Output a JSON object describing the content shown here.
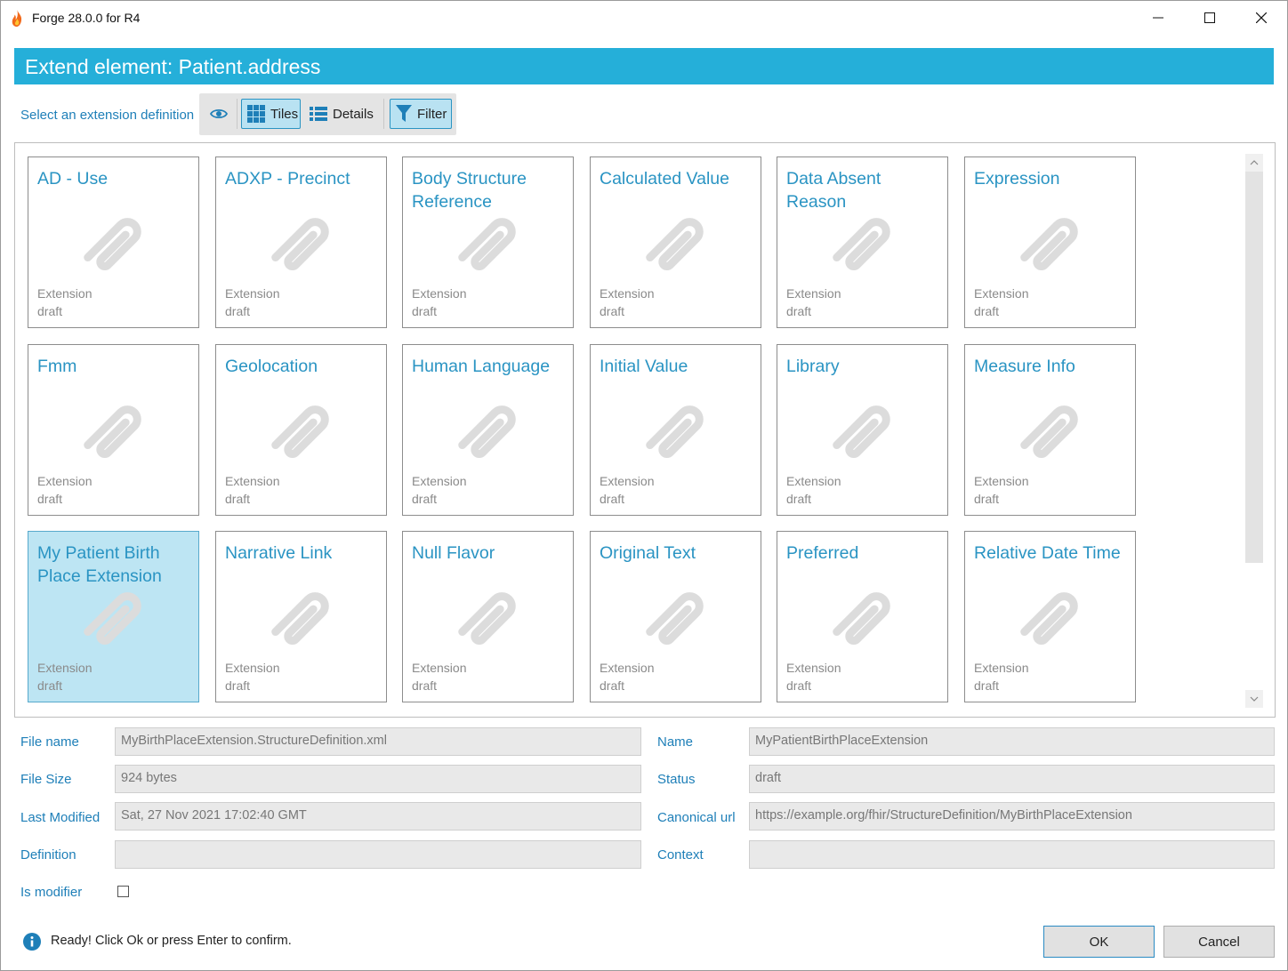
{
  "window": {
    "title": "Forge 28.0.0 for R4",
    "controls": [
      "minimize-icon",
      "maximize-icon",
      "close-icon"
    ]
  },
  "header": {
    "title": "Extend element: Patient.address",
    "color": "#25afd9"
  },
  "selector": {
    "label": "Select an extension definition",
    "tiles_label": "Tiles",
    "details_label": "Details",
    "filter_label": "Filter",
    "active_view": "Tiles",
    "filter_active": true
  },
  "tiles": [
    {
      "name": "AD - Use",
      "type": "Extension",
      "status": "draft"
    },
    {
      "name": "ADXP - Precinct",
      "type": "Extension",
      "status": "draft"
    },
    {
      "name": "Body Structure Reference",
      "type": "Extension",
      "status": "draft"
    },
    {
      "name": "Calculated Value",
      "type": "Extension",
      "status": "draft"
    },
    {
      "name": "Data Absent Reason",
      "type": "Extension",
      "status": "draft"
    },
    {
      "name": "Expression",
      "type": "Extension",
      "status": "draft"
    },
    {
      "name": "Fmm",
      "type": "Extension",
      "status": "draft"
    },
    {
      "name": "Geolocation",
      "type": "Extension",
      "status": "draft"
    },
    {
      "name": "Human Language",
      "type": "Extension",
      "status": "draft"
    },
    {
      "name": "Initial Value",
      "type": "Extension",
      "status": "draft"
    },
    {
      "name": "Library",
      "type": "Extension",
      "status": "draft"
    },
    {
      "name": "Measure Info",
      "type": "Extension",
      "status": "draft"
    },
    {
      "name": "My Patient Birth Place Extension",
      "type": "Extension",
      "status": "draft",
      "selected": true
    },
    {
      "name": "Narrative Link",
      "type": "Extension",
      "status": "draft"
    },
    {
      "name": "Null Flavor",
      "type": "Extension",
      "status": "draft"
    },
    {
      "name": "Original Text",
      "type": "Extension",
      "status": "draft"
    },
    {
      "name": "Preferred",
      "type": "Extension",
      "status": "draft"
    },
    {
      "name": "Relative Date Time",
      "type": "Extension",
      "status": "draft"
    }
  ],
  "details": {
    "file_name_label": "File name",
    "file_name": "MyBirthPlaceExtension.StructureDefinition.xml",
    "file_size_label": "File Size",
    "file_size": "924 bytes",
    "last_modified_label": "Last Modified",
    "last_modified": "Sat, 27 Nov 2021 17:02:40 GMT",
    "definition_label": "Definition",
    "definition": "",
    "is_modifier_label": "Is modifier",
    "is_modifier": false,
    "name_label": "Name",
    "name": "MyPatientBirthPlaceExtension",
    "status_label": "Status",
    "status": "draft",
    "canonical_url_label": "Canonical url",
    "canonical_url": "https://example.org/fhir/StructureDefinition/MyBirthPlaceExtension",
    "context_label": "Context",
    "context": ""
  },
  "statusbar": {
    "icon": "info-icon",
    "message": "Ready! Click Ok or press Enter to confirm."
  },
  "buttons": {
    "ok": "OK",
    "cancel": "Cancel"
  }
}
